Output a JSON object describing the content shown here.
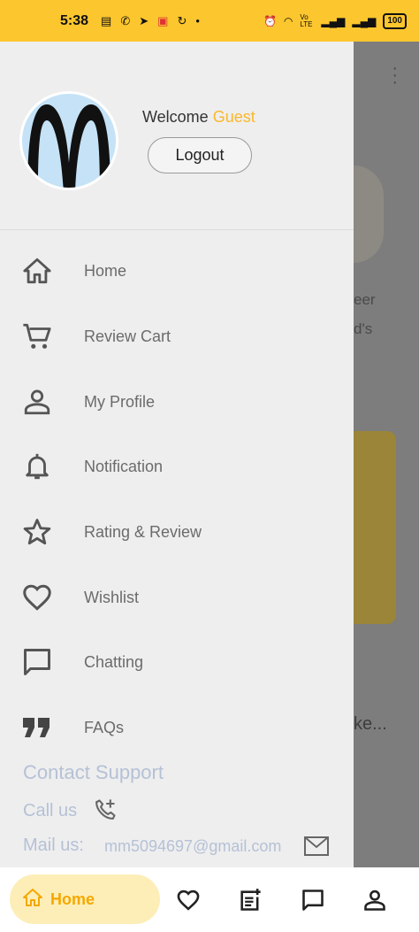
{
  "status_bar": {
    "time": "5:38",
    "battery": "100",
    "network": "Vo LTE"
  },
  "background_app": {
    "text1": "eer",
    "text2": "d's",
    "text3": "ke..."
  },
  "drawer": {
    "welcome_prefix": "Welcome",
    "user_name": "Guest",
    "logout_label": "Logout",
    "menu": [
      {
        "label": "Home",
        "icon": "home-icon"
      },
      {
        "label": "Review Cart",
        "icon": "cart-icon"
      },
      {
        "label": "My Profile",
        "icon": "person-icon"
      },
      {
        "label": "Notification",
        "icon": "bell-icon"
      },
      {
        "label": "Rating & Review",
        "icon": "star-icon"
      },
      {
        "label": "Wishlist",
        "icon": "heart-icon"
      },
      {
        "label": "Chatting",
        "icon": "chat-icon"
      },
      {
        "label": "FAQs",
        "icon": "quote-icon"
      }
    ],
    "contact": {
      "title": "Contact Support",
      "call_label": "Call us",
      "mail_label": "Mail us:",
      "mail_value": "mm5094697@gmail.com"
    }
  },
  "bottom_nav": {
    "home_label": "Home"
  },
  "colors": {
    "accent": "#fcc62e",
    "guest": "#fbb829",
    "contact_text": "#b5c1d6"
  }
}
